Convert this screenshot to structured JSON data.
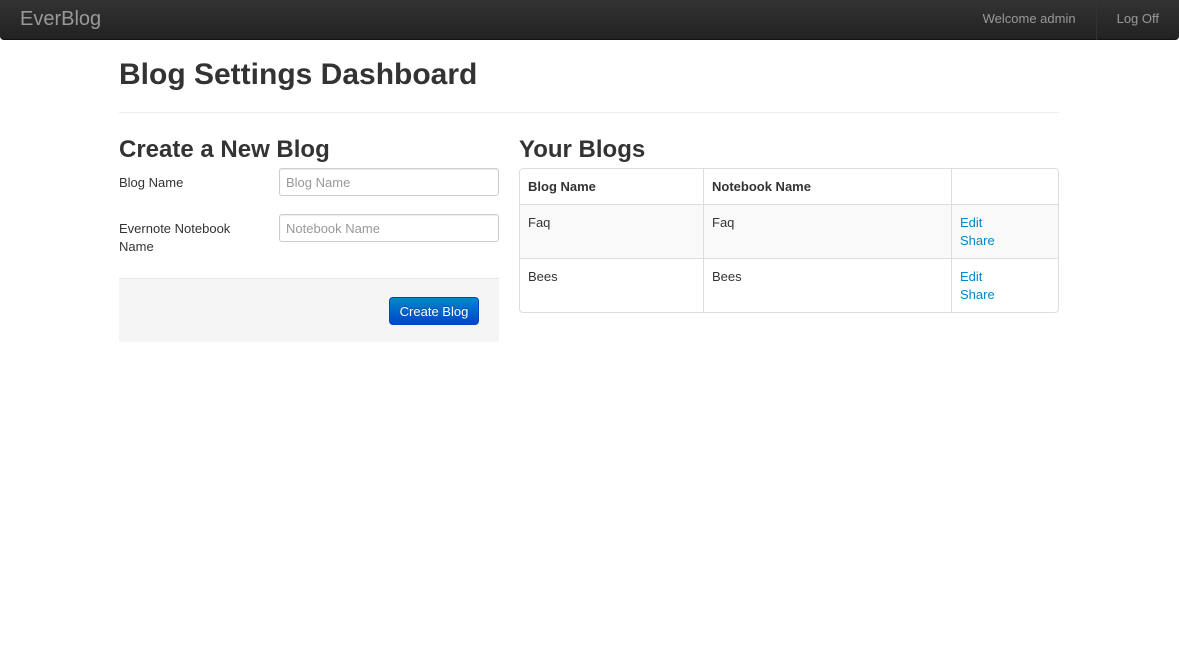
{
  "navbar": {
    "brand": "EverBlog",
    "welcome": "Welcome admin",
    "logoff": "Log Off"
  },
  "page": {
    "title": "Blog Settings Dashboard"
  },
  "create_form": {
    "title": "Create a New Blog",
    "blog_name_label": "Blog Name",
    "blog_name_placeholder": "Blog Name",
    "blog_name_value": "",
    "notebook_label": "Evernote Notebook Name",
    "notebook_placeholder": "Notebook Name",
    "notebook_value": "",
    "submit_label": "Create Blog"
  },
  "blogs": {
    "title": "Your Blogs",
    "columns": [
      "Blog Name",
      "Notebook Name",
      ""
    ],
    "rows": [
      {
        "blog_name": "Faq",
        "notebook_name": "Faq",
        "edit_label": "Edit",
        "share_label": "Share"
      },
      {
        "blog_name": "Bees",
        "notebook_name": "Bees",
        "edit_label": "Edit",
        "share_label": "Share"
      }
    ]
  },
  "colors": {
    "navbar_bg": "#222222",
    "link": "#0088cc",
    "primary_button": "#0074cc"
  }
}
